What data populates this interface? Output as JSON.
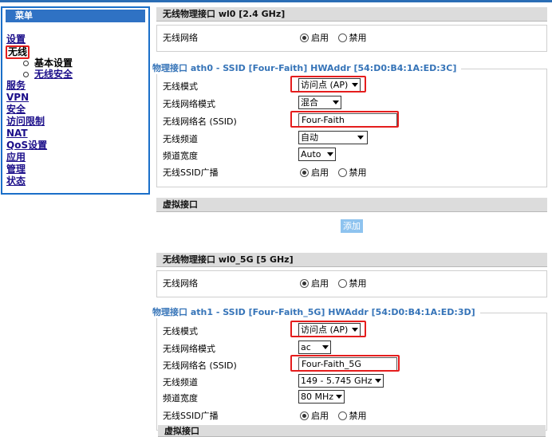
{
  "sidebar": {
    "header": "菜单",
    "items": [
      {
        "label": "设置"
      },
      {
        "label": "无线",
        "active": true
      },
      {
        "label": "服务"
      },
      {
        "label": "VPN"
      },
      {
        "label": "安全"
      },
      {
        "label": "访问限制"
      },
      {
        "label": "NAT"
      },
      {
        "label": "QoS设置"
      },
      {
        "label": "应用"
      },
      {
        "label": "管理"
      },
      {
        "label": "状态"
      }
    ],
    "subitems": [
      {
        "label": "基本设置",
        "current": true
      },
      {
        "label": "无线安全",
        "current": false
      }
    ]
  },
  "iface24": {
    "header": "无线物理接口 wl0 [2.4 GHz]",
    "network_label": "无线网络",
    "legend": "物理接口 ath0 - SSID [Four-Faith] HWAddr [54:D0:B4:1A:ED:3C]",
    "rows": {
      "mode_label": "无线模式",
      "mode_value": "访问点 (AP)",
      "netmode_label": "无线网络模式",
      "netmode_value": "混合",
      "ssid_label": "无线网络名 (SSID)",
      "ssid_value": "Four-Faith",
      "channel_label": "无线频道",
      "channel_value": "自动",
      "width_label": "频道宽度",
      "width_value": "Auto",
      "broadcast_label": "无线SSID广播"
    }
  },
  "radio": {
    "enable": "启用",
    "disable": "禁用"
  },
  "virtual": {
    "header": "虚拟接口",
    "add_button": "添加"
  },
  "iface5": {
    "header": "无线物理接口 wl0_5G [5 GHz]",
    "network_label": "无线网络",
    "legend": "物理接口 ath1 - SSID [Four-Faith_5G] HWAddr [54:D0:B4:1A:ED:3D]",
    "rows": {
      "mode_label": "无线模式",
      "mode_value": "访问点 (AP)",
      "netmode_label": "无线网络模式",
      "netmode_value": "ac",
      "ssid_label": "无线网络名 (SSID)",
      "ssid_value": "Four-Faith_5G",
      "channel_label": "无线频道",
      "channel_value": "149 - 5.745 GHz",
      "width_label": "频道宽度",
      "width_value": "80 MHz",
      "broadcast_label": "无线SSID广播"
    }
  },
  "virtual2": {
    "header": "虚拟接口"
  },
  "colors": {
    "accent": "#2f72c4",
    "highlight": "#e51d1d",
    "link": "#1c0f8a",
    "legend": "#3674b8"
  }
}
